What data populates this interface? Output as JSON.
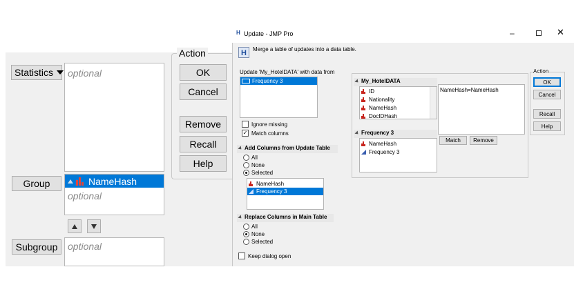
{
  "left": {
    "statistics_label": "Statistics",
    "statistics_placeholder": "optional",
    "group_label": "Group",
    "group_item": "NameHash",
    "group_placeholder": "optional",
    "subgroup_label": "Subgroup",
    "subgroup_placeholder": "optional",
    "action_title": "Action",
    "buttons": [
      "OK",
      "Cancel",
      "Remove",
      "Recall",
      "Help"
    ]
  },
  "dialog": {
    "title": "Update - JMP Pro",
    "description": "Merge a table of updates into a data table.",
    "update_label": "Update 'My_HotelDATA' with data from",
    "update_tables": [
      "Frequency 3"
    ],
    "ignore_missing": "Ignore missing",
    "match_columns": "Match columns",
    "add_columns_title": "Add Columns from Update Table",
    "add_options": [
      "All",
      "None",
      "Selected"
    ],
    "add_selected_index": 2,
    "add_columns_list": [
      "NameHash",
      "Frequency 3"
    ],
    "replace_columns_title": "Replace Columns in Main Table",
    "replace_options": [
      "All",
      "None",
      "Selected"
    ],
    "replace_selected_index": 1,
    "keep_dialog_open": "Keep dialog open",
    "main_table_name": "My_HotelDATA",
    "main_columns": [
      "ID",
      "Nationality",
      "NameHash",
      "DocIDHash"
    ],
    "update_table_name": "Frequency 3",
    "update_columns": [
      {
        "name": "NameHash",
        "type": "nominal"
      },
      {
        "name": "Frequency 3",
        "type": "continuous"
      }
    ],
    "match_pair": "NameHash=NameHash",
    "match_button": "Match",
    "remove_button": "Remove",
    "action_title": "Action",
    "action_buttons": [
      "OK",
      "Cancel",
      "Recall",
      "Help"
    ]
  },
  "colors": {
    "selection": "#0078d7",
    "nominal_icon": "#c8261f",
    "continuous_icon": "#3a5fb0"
  }
}
